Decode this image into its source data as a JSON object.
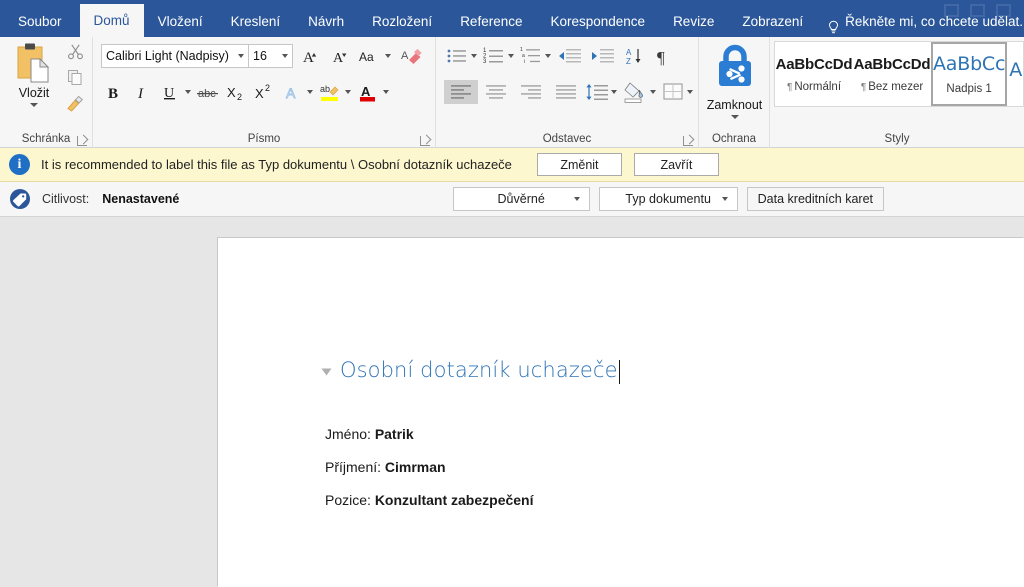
{
  "window": {
    "app": "Word"
  },
  "ribbon_tabs": [
    {
      "label": "Soubor",
      "active": false,
      "name": "tab-soubor"
    },
    {
      "label": "Domů",
      "active": true,
      "name": "tab-domu"
    },
    {
      "label": "Vložení",
      "active": false,
      "name": "tab-vlozeni"
    },
    {
      "label": "Kreslení",
      "active": false,
      "name": "tab-kresleni"
    },
    {
      "label": "Návrh",
      "active": false,
      "name": "tab-navrh"
    },
    {
      "label": "Rozložení",
      "active": false,
      "name": "tab-rozlozeni"
    },
    {
      "label": "Reference",
      "active": false,
      "name": "tab-reference"
    },
    {
      "label": "Korespondence",
      "active": false,
      "name": "tab-korespondence"
    },
    {
      "label": "Revize",
      "active": false,
      "name": "tab-revize"
    },
    {
      "label": "Zobrazení",
      "active": false,
      "name": "tab-zobrazeni"
    }
  ],
  "tell_me": {
    "text": "Řekněte mi, co chcete udělat.",
    "icon": "lightbulb-icon"
  },
  "ribbon": {
    "clipboard": {
      "group_label": "Schránka",
      "paste_label": "Vložit",
      "buttons": [
        "cut-icon",
        "copy-icon",
        "format-painter-icon"
      ]
    },
    "font": {
      "group_label": "Písmo",
      "font_name": "Calibri Light (Nadpisy)",
      "font_size": "16",
      "grow_font": "A",
      "shrink_font": "A",
      "change_case": "Aa",
      "clear_formatting": "A",
      "bold": "B",
      "italic": "I",
      "underline": "U",
      "strikethrough": "abc",
      "subscript": "X2",
      "superscript": "X2",
      "text_effects": "A",
      "highlight": "ab",
      "font_color": "A"
    },
    "paragraph": {
      "group_label": "Odstavec",
      "buttons": [
        "bullets-icon",
        "numbering-icon",
        "multilevel-list-icon",
        "decrease-indent-icon",
        "increase-indent-icon",
        "sort-icon",
        "show-formatting-marks-icon",
        "align-left-icon",
        "align-center-icon",
        "align-right-icon",
        "justify-icon",
        "line-spacing-icon",
        "shading-icon",
        "borders-icon"
      ]
    },
    "protection": {
      "group_label": "Ochrana",
      "lock_label": "Zamknout",
      "icon": "lock-share-icon"
    },
    "styles": {
      "group_label": "Styly",
      "items": [
        {
          "preview": "AaBbCcDd",
          "name": "Normální",
          "selected": false,
          "heading": false
        },
        {
          "preview": "AaBbCcDd",
          "name": "Bez mezer",
          "selected": false,
          "heading": false
        },
        {
          "preview": "AaBbCc",
          "name": "Nadpis 1",
          "selected": true,
          "heading": true
        },
        {
          "preview": "A",
          "name": "",
          "selected": false,
          "heading": true
        }
      ]
    }
  },
  "info_bar": {
    "icon": "info-icon",
    "message": "It is recommended to label this file as Typ dokumentu \\ Osobní dotazník uchazeče",
    "change_button": "Změnit",
    "close_button": "Zavřít",
    "background_color": "#fdf7cf"
  },
  "sensitivity_bar": {
    "icon": "sensitivity-tag-icon",
    "label": "Citlivost:",
    "value": "Nenastavené",
    "dropdown_1": "Důvěrné",
    "dropdown_2": "Typ dokumentu",
    "button": "Data kreditních karet"
  },
  "document": {
    "heading": "Osobní dotazník uchazeče",
    "heading_color": "#2e74b5",
    "lines": [
      {
        "label": "Jméno: ",
        "value": "Patrik"
      },
      {
        "label": "Příjmení: ",
        "value": "Cimrman"
      },
      {
        "label": "Pozice: ",
        "value": "Konzultant zabezpečení"
      }
    ]
  },
  "colors": {
    "ribbon_blue": "#2b579a",
    "ribbon_bg": "#f6f6f6",
    "doc_bg": "#e6e6e6",
    "accent_heading": "#2e74b5",
    "info_yellow": "#fdf7cf"
  }
}
